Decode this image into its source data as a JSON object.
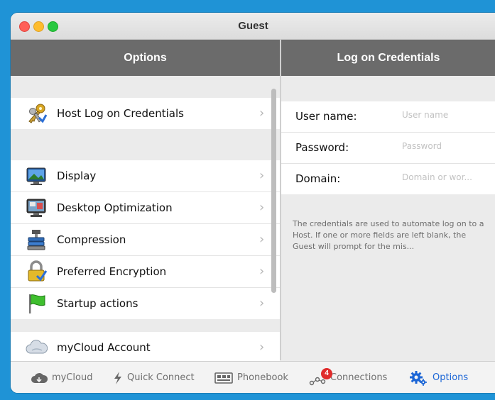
{
  "window": {
    "title": "Guest"
  },
  "left_header": "Options",
  "right_header": "Log on Credentials",
  "options": {
    "group1": [
      {
        "label": "Host Log on Credentials",
        "icon": "keys-icon"
      }
    ],
    "group2": [
      {
        "label": "Display",
        "icon": "display-icon"
      },
      {
        "label": "Desktop Optimization",
        "icon": "desktop-icon"
      },
      {
        "label": "Compression",
        "icon": "compression-icon"
      },
      {
        "label": "Preferred Encryption",
        "icon": "lock-icon"
      },
      {
        "label": "Startup actions",
        "icon": "flag-icon"
      }
    ],
    "group3": [
      {
        "label": "myCloud Account",
        "icon": "cloud-icon"
      }
    ]
  },
  "credentials": {
    "username_label": "User name:",
    "username_placeholder": "User name",
    "password_label": "Password:",
    "password_placeholder": "Password",
    "domain_label": "Domain:",
    "domain_placeholder": "Domain or wor...",
    "note": "The credentials are used to automate log on to a Host. If one or more fields are left blank, the Guest will prompt for the mis..."
  },
  "tabbar": {
    "mycloud": "myCloud",
    "quick_connect": "Quick Connect",
    "phonebook": "Phonebook",
    "connections": "Connections",
    "connections_badge": "4",
    "options": "Options"
  },
  "colors": {
    "background": "#1f93d6",
    "header": "#6b6b6b",
    "active_tab": "#1c66d6",
    "badge": "#e02b2b"
  }
}
